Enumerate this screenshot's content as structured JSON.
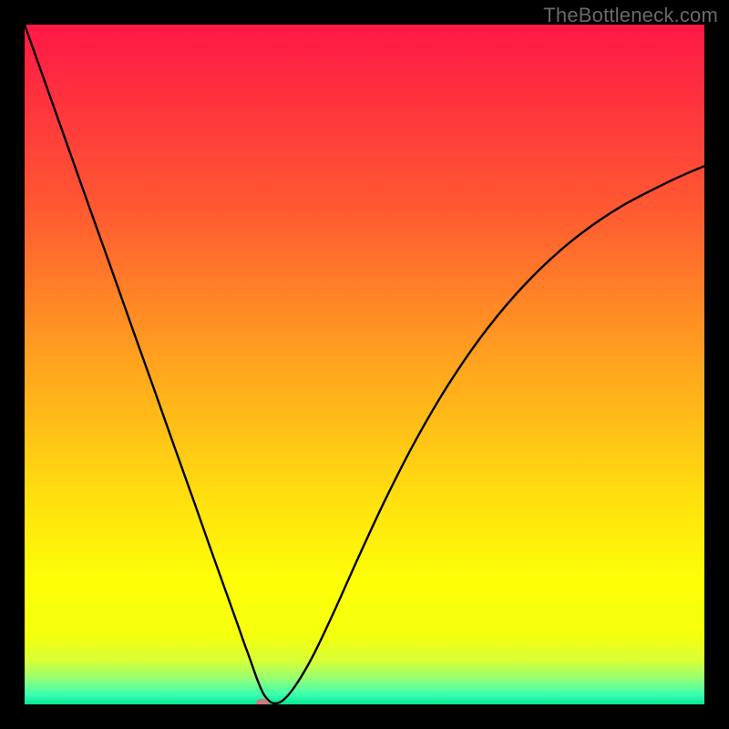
{
  "watermark": "TheBottleneck.com",
  "chart_data": {
    "type": "line",
    "title": "",
    "xlabel": "",
    "ylabel": "",
    "xlim": [
      0,
      100
    ],
    "ylim": [
      0,
      100
    ],
    "grid": false,
    "legend": false,
    "annotations": [],
    "series": [
      {
        "name": "bottleneck-curve",
        "x": [
          0,
          5,
          10,
          13,
          16,
          19,
          22,
          25,
          27,
          29,
          30.5,
          31.5,
          32.3,
          33,
          33.6,
          34.4,
          35.3,
          36.5,
          38,
          40,
          42.5,
          45.5,
          49,
          53,
          57.5,
          62.5,
          68,
          74,
          80.5,
          87.5,
          95,
          100
        ],
        "y": [
          100,
          85.9,
          71.8,
          63.4,
          54.9,
          46.5,
          38,
          29.6,
          23.9,
          18.3,
          14.1,
          11.3,
          9,
          7.1,
          5.4,
          3.2,
          1.3,
          0.2,
          0.6,
          3,
          7.3,
          13.6,
          21.4,
          30,
          38.8,
          47.3,
          55.2,
          62.2,
          68.2,
          73.1,
          77,
          79.2
        ]
      }
    ],
    "marker": {
      "x": 35,
      "y": 0,
      "color": "#cf7a7c"
    },
    "background_gradient": {
      "type": "vertical",
      "stops": [
        {
          "pos": 0.0,
          "color": "#ff1846"
        },
        {
          "pos": 0.27,
          "color": "#ff5932"
        },
        {
          "pos": 0.5,
          "color": "#ffa41e"
        },
        {
          "pos": 0.7,
          "color": "#ffe00f"
        },
        {
          "pos": 0.82,
          "color": "#feff07"
        },
        {
          "pos": 0.9,
          "color": "#f4ff0f"
        },
        {
          "pos": 0.935,
          "color": "#d8ff35"
        },
        {
          "pos": 0.96,
          "color": "#9bff6f"
        },
        {
          "pos": 0.985,
          "color": "#3effb0"
        },
        {
          "pos": 1.0,
          "color": "#04e792"
        }
      ]
    }
  }
}
